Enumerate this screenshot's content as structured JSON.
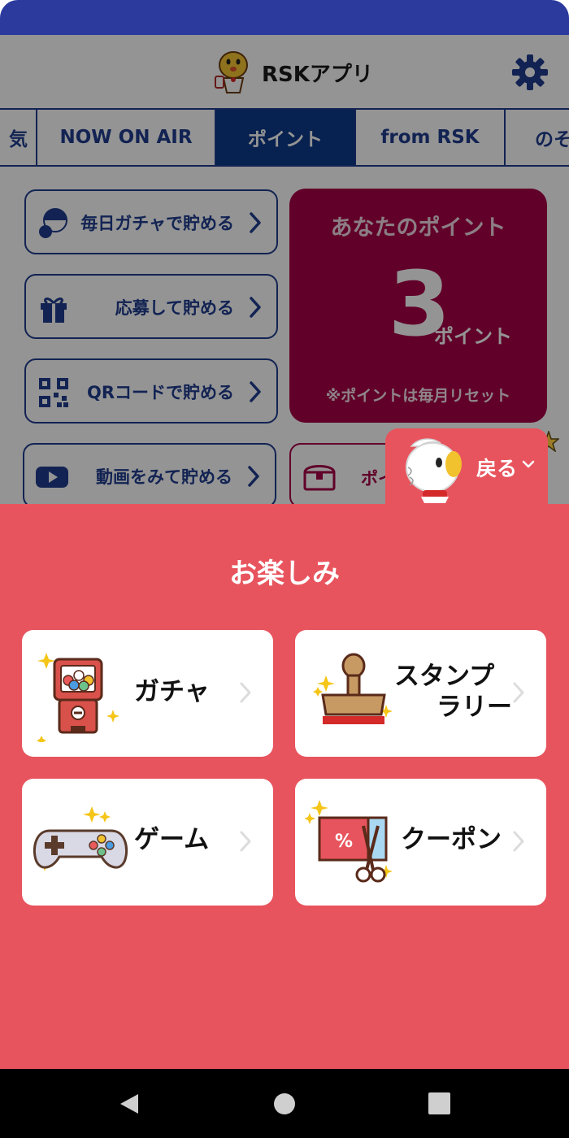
{
  "header": {
    "title": "RSKアプリ"
  },
  "tabs": [
    {
      "label": "気"
    },
    {
      "label": "NOW ON AIR"
    },
    {
      "label": "ポイント"
    },
    {
      "label": "from RSK"
    },
    {
      "label": "のそ"
    }
  ],
  "earn": {
    "gacha": "毎日ガチャで貯める",
    "apply": "応募して貯める",
    "qr": "QRコードで貯める",
    "video": "動画をみて貯める"
  },
  "points": {
    "title": "あなたのポイント",
    "value": "3",
    "unit": "ポイント",
    "note": "※ポイントは毎月リセット"
  },
  "treasure": {
    "label": "ポイ"
  },
  "back": {
    "label": "戻る"
  },
  "sheet": {
    "title": "お楽しみ",
    "cards": [
      {
        "label": "ガチャ",
        "icon": "gacha-machine-icon"
      },
      {
        "label_line1": "スタンプ",
        "label_line2": "ラリー",
        "icon": "stamp-icon"
      },
      {
        "label": "ゲーム",
        "icon": "game-controller-icon"
      },
      {
        "label": "クーポン",
        "icon": "coupon-scissors-icon"
      }
    ]
  },
  "colors": {
    "status_bar": "#2b3a9c",
    "brand_blue": "#1f3d8f",
    "points_card": "#a70047",
    "sheet": "#e8545d"
  }
}
